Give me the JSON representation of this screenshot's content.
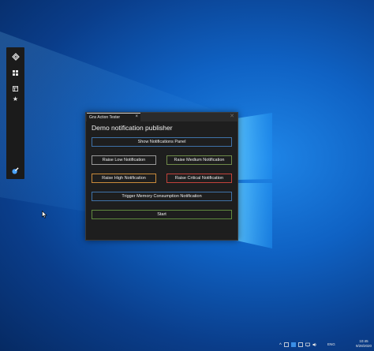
{
  "app": {
    "tab_label": "Gns Action Tester",
    "tab_close_glyph": "×",
    "window_close_glyph": "✕",
    "heading": "Demo notification publisher",
    "buttons": {
      "show_panel": "Show Notifications Panel",
      "raise_low": "Raise Low Notification",
      "raise_medium": "Raise Medium Notification",
      "raise_high": "Raise High Notification",
      "raise_critical": "Raise Critical Notification",
      "trigger_memory": "Trigger Memory Consumption Notification",
      "start": "Start"
    },
    "colors": {
      "show_panel_border": "#3f72a8",
      "low_border": "#9a9a9a",
      "medium_border": "#6f8a4a",
      "high_border": "#c98a3a",
      "critical_border": "#c2423a",
      "memory_border": "#3f72a8",
      "start_border": "#5f8a3f"
    }
  },
  "side_dock": {
    "icons": [
      "gns-logo-icon",
      "grid-icon",
      "window-icon",
      "star-icon",
      "paint-icon"
    ]
  },
  "taskbar": {
    "language": "ENG",
    "time": "10:45",
    "date": "9/28/2020"
  }
}
